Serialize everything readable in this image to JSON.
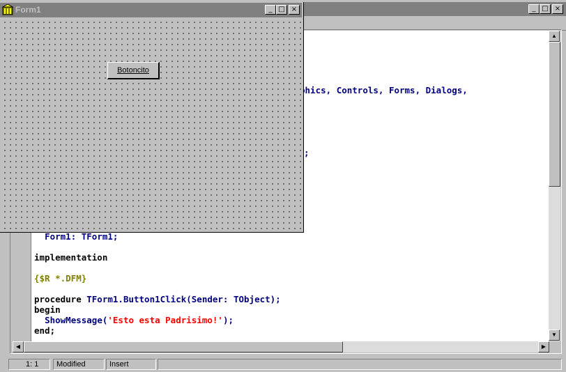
{
  "editor_window": {
    "minimize_glyph": "_",
    "maximize_glyph": "□",
    "close_glyph": "×",
    "scroll_up_glyph": "▲",
    "scroll_down_glyph": "▼",
    "scroll_left_glyph": "◀",
    "scroll_right_glyph": "▶",
    "code": {
      "uses_tail_a": "phics, ",
      "uses_tail_b": "Controls, Forms, Dialogs,",
      "semicolon": ";",
      "var_indent": "  ",
      "var_line": "Form1: TForm1;",
      "implementation": "implementation",
      "directive": "{$R *.DFM}",
      "procedure_kw": "procedure",
      "procedure_sig_a": " TForm1.Button1Click(Sender: TObject);",
      "begin": "begin",
      "call_indent": "  ",
      "call_a": "ShowMessage(",
      "call_str": "'Esto esta Padrisimo!'",
      "call_b": ");",
      "end": "end;"
    }
  },
  "form_window": {
    "title": "Form1",
    "minimize_glyph": "_",
    "maximize_glyph": "□",
    "close_glyph": "×",
    "button_label": "Botoncito"
  },
  "status_bar": {
    "position": "1:   1",
    "modified": "Modified",
    "mode": "Insert"
  },
  "colors": {
    "form_title_bar_inactive": "#808080",
    "editor_background": "#ffffff",
    "identifier": "#000080",
    "keyword": "#000000",
    "directive": "#808000",
    "string": "#ff0000"
  }
}
